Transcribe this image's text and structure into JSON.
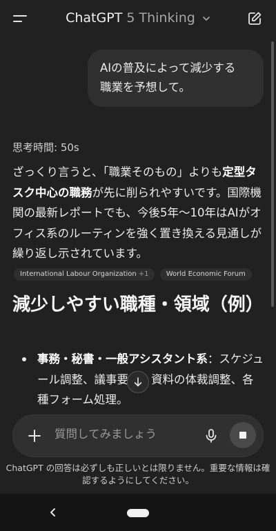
{
  "header": {
    "app_name": "ChatGPT",
    "model_name": "5 Thinking"
  },
  "conversation": {
    "user_message_lines": [
      "AIの普及によって減少する",
      "職業を予想して。"
    ],
    "thinking_label": "思考時間: 50s",
    "answer_segments": [
      "ざっくり言うと、「職業そのもの」よりも",
      "定型タスク中心の職務",
      "が先に削られやすいです。国際機関の最新レポートでも、今後5年〜10年はAIがオフィス系のルーティンを強く置き換える見通しが繰り返し示されています。"
    ],
    "citations": [
      {
        "label": "International Labour Organization",
        "extra": "+1"
      },
      {
        "label": "World Economic Forum"
      }
    ],
    "section_heading": "減少しやすい職種・領域（例）",
    "list_items": [
      {
        "title": "事務・秘書・一般アシスタント系",
        "sep": "：",
        "desc": "スケジュール調整、議事要約、資料の体裁調整、各種フォーム処理。"
      }
    ]
  },
  "composer": {
    "placeholder": "質問してみましょう"
  },
  "disclaimer": "ChatGPT の回答は必ずしも正しいとは限りません。重要な情報は確認するようにしてください。",
  "icons": {
    "menu": "menu-icon",
    "edit": "new-chat-icon",
    "plus": "plus-icon",
    "mic": "mic-icon",
    "stop": "stop-icon",
    "scroll_down": "arrow-down-icon",
    "back": "back-icon"
  }
}
